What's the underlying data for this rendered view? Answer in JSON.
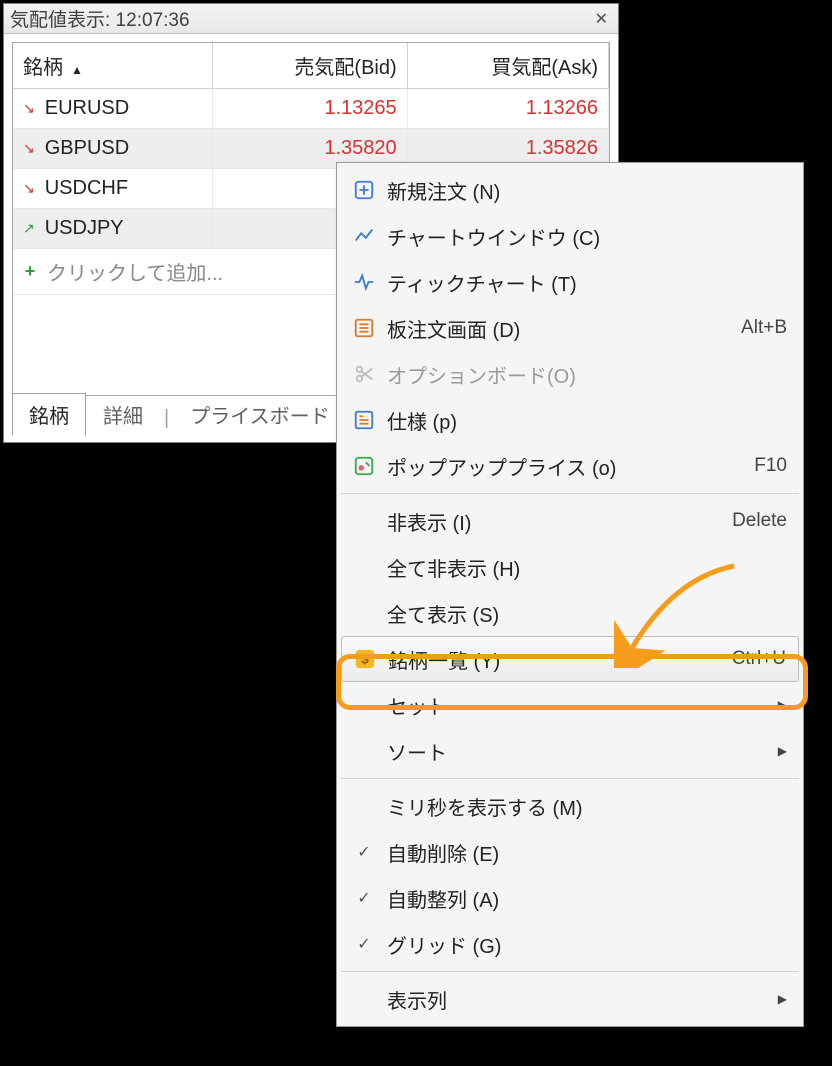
{
  "titlebar": {
    "title": "気配値表示: 12:07:36"
  },
  "columns": {
    "symbol": "銘柄",
    "bid": "売気配(Bid)",
    "ask": "買気配(Ask)"
  },
  "rows": [
    {
      "sym": "EURUSD",
      "dir": "dn",
      "bid": "1.13265",
      "ask": "1.13266",
      "sel": false
    },
    {
      "sym": "GBPUSD",
      "dir": "dn",
      "bid": "1.35820",
      "ask": "1.35826",
      "sel": true
    },
    {
      "sym": "USDCHF",
      "dir": "dn",
      "bid": "",
      "ask": "",
      "sel": false
    },
    {
      "sym": "USDJPY",
      "dir": "up",
      "bid": "",
      "ask": "",
      "sel": true
    }
  ],
  "addRow": {
    "label": "クリックして追加..."
  },
  "tabs": {
    "t1": "銘柄",
    "t2": "詳細",
    "t3": "プライスボード"
  },
  "menu": {
    "newOrder": {
      "label": "新規注文 (N)"
    },
    "chartWin": {
      "label": "チャートウインドウ (C)"
    },
    "tickChart": {
      "label": "ティックチャート (T)"
    },
    "dom": {
      "label": "板注文画面 (D)",
      "accel": "Alt+B"
    },
    "optBoard": {
      "label": "オプションボード(O)"
    },
    "spec": {
      "label": "仕様 (p)"
    },
    "popup": {
      "label": "ポップアッププライス (o)",
      "accel": "F10"
    },
    "hide": {
      "label": "非表示 (I)",
      "accel": "Delete"
    },
    "hideAll": {
      "label": "全て非表示 (H)"
    },
    "showAll": {
      "label": "全て表示 (S)"
    },
    "symbols": {
      "label": "銘柄一覧 (Y)",
      "accel": "Ctrl+U"
    },
    "sets": {
      "label": "セット"
    },
    "sort": {
      "label": "ソート"
    },
    "showMs": {
      "label": "ミリ秒を表示する (M)"
    },
    "autoDel": {
      "label": "自動削除 (E)"
    },
    "autoArr": {
      "label": "自動整列 (A)"
    },
    "grid": {
      "label": "グリッド (G)"
    },
    "cols": {
      "label": "表示列"
    }
  }
}
